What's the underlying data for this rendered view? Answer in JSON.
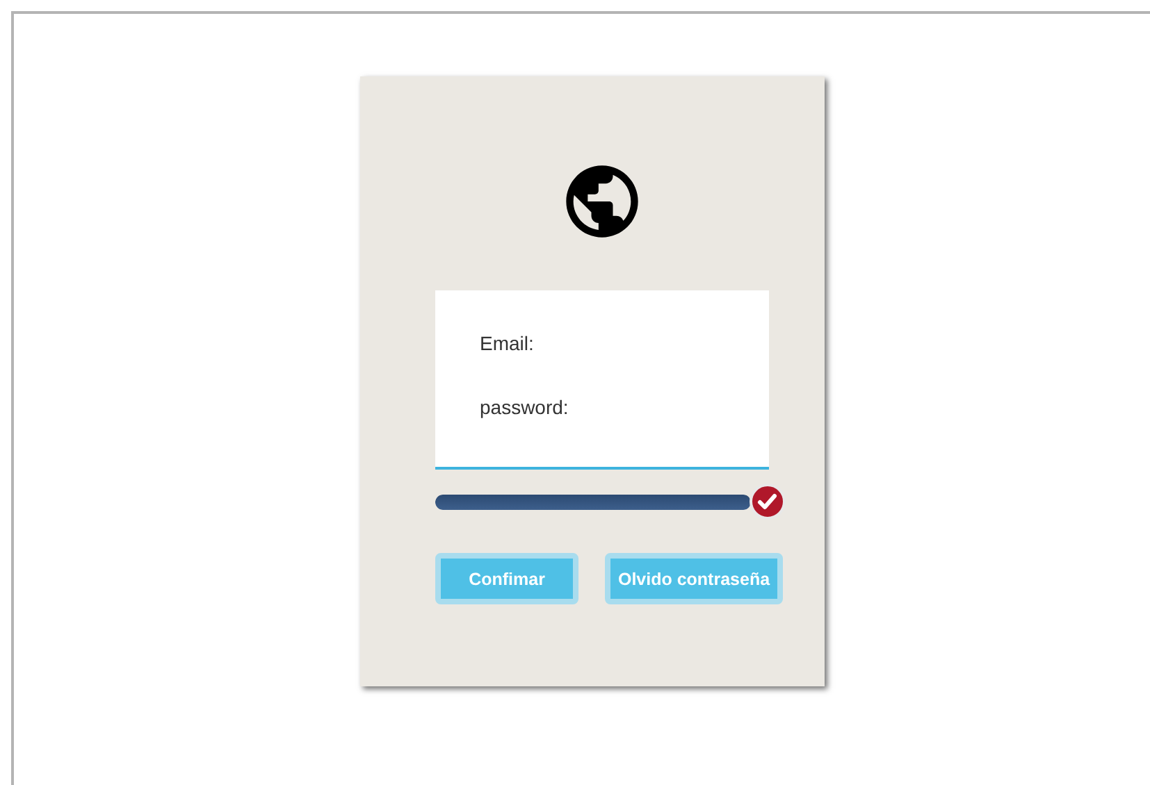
{
  "form": {
    "fields": [
      {
        "label": "Email:"
      },
      {
        "label": "password:"
      }
    ]
  },
  "progress": {
    "level": 1
  },
  "buttons": [
    {
      "label": "Confimar"
    },
    {
      "label": "Olvido contraseña"
    }
  ]
}
